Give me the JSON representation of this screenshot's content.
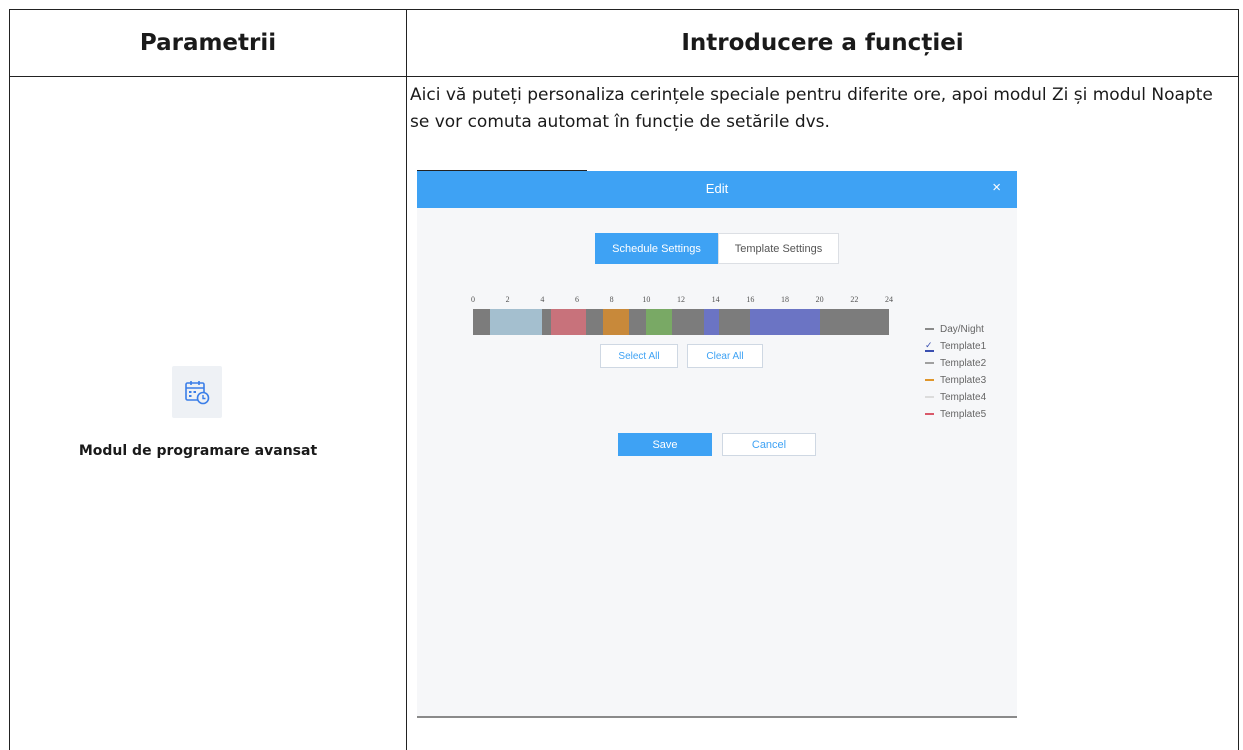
{
  "table": {
    "header_params": "Parametrii",
    "header_intro": "Introducere a funcției"
  },
  "row": {
    "param_label": "Modul de programare avansat",
    "param_icon": "calendar-clock-icon",
    "description": "Aici vă puteți personaliza cerințele speciale pentru diferite ore, apoi modul Zi și modul Noapte se vor comuta automat în funcție de setările dvs."
  },
  "dialog": {
    "title": "Edit",
    "close_glyph": "×",
    "tabs": [
      "Schedule Settings",
      "Template Settings"
    ],
    "active_tab": 0,
    "tick_labels": [
      "0",
      "2",
      "4",
      "6",
      "8",
      "10",
      "12",
      "14",
      "16",
      "18",
      "20",
      "22",
      "24"
    ],
    "schedule_segments": [
      {
        "start": 0,
        "end": 1,
        "color": "#7c7c7c"
      },
      {
        "start": 1,
        "end": 4,
        "color": "#a4bfcf"
      },
      {
        "start": 4,
        "end": 4.5,
        "color": "#7c7c7c"
      },
      {
        "start": 4.5,
        "end": 6.5,
        "color": "#c8727b"
      },
      {
        "start": 6.5,
        "end": 7.5,
        "color": "#7c7c7c"
      },
      {
        "start": 7.5,
        "end": 9,
        "color": "#c8893a"
      },
      {
        "start": 9,
        "end": 10,
        "color": "#7c7c7c"
      },
      {
        "start": 10,
        "end": 11.5,
        "color": "#79a965"
      },
      {
        "start": 11.5,
        "end": 13.3,
        "color": "#7c7c7c"
      },
      {
        "start": 13.3,
        "end": 14.2,
        "color": "#6b74c4"
      },
      {
        "start": 14.2,
        "end": 16,
        "color": "#7c7c7c"
      },
      {
        "start": 16,
        "end": 20,
        "color": "#6b74c4"
      },
      {
        "start": 20,
        "end": 24,
        "color": "#7c7c7c"
      }
    ],
    "select_all": "Select All",
    "clear_all": "Clear All",
    "legend": [
      {
        "label": "Day/Night",
        "color": "#8a8a8a",
        "checked": false
      },
      {
        "label": "Template1",
        "color": "#3a4fb0",
        "checked": true
      },
      {
        "label": "Template2",
        "color": "#a0a0a0",
        "checked": false
      },
      {
        "label": "Template3",
        "color": "#e0962a",
        "checked": false
      },
      {
        "label": "Template4",
        "color": "#dcdcdc",
        "checked": false
      },
      {
        "label": "Template5",
        "color": "#d9596a",
        "checked": false
      }
    ],
    "save": "Save",
    "cancel": "Cancel"
  }
}
